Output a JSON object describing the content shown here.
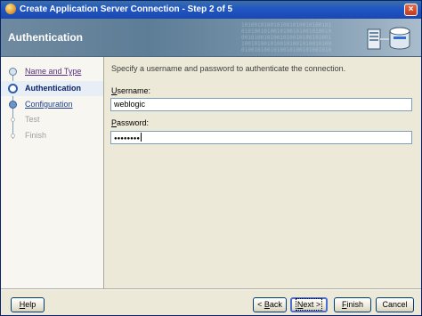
{
  "window": {
    "title": "Create Application Server Connection - Step 2 of 5",
    "close_label": "×"
  },
  "banner": {
    "title": "Authentication"
  },
  "train": {
    "steps": [
      {
        "label": "Name and Type",
        "state": "visited"
      },
      {
        "label": "Authentication",
        "state": "current"
      },
      {
        "label": "Configuration",
        "state": "next"
      },
      {
        "label": "Test",
        "state": "disabled"
      },
      {
        "label": "Finish",
        "state": "disabled"
      }
    ]
  },
  "content": {
    "instructions": "Specify a username and password to authenticate the connection.",
    "username": {
      "label_mnemonic": "U",
      "label_rest": "sername:",
      "value": "weblogic"
    },
    "password": {
      "label_mnemonic": "P",
      "label_rest": "assword:",
      "value": "●●●●●●●●"
    }
  },
  "buttons": {
    "help": {
      "mnemonic": "H",
      "rest": "elp"
    },
    "back": {
      "pre": "< ",
      "mnemonic": "B",
      "rest": "ack"
    },
    "next": {
      "mnemonic": "N",
      "rest": "ext >"
    },
    "finish": {
      "mnemonic": "F",
      "rest": "inish"
    },
    "cancel": {
      "label": "Cancel"
    }
  },
  "colors": {
    "titlebar": "#2156c5",
    "banner": "#5d7d96",
    "accent": "#0a246a"
  },
  "icons": {
    "title": "oracle-app-icon",
    "banner": "server-database-icon"
  }
}
